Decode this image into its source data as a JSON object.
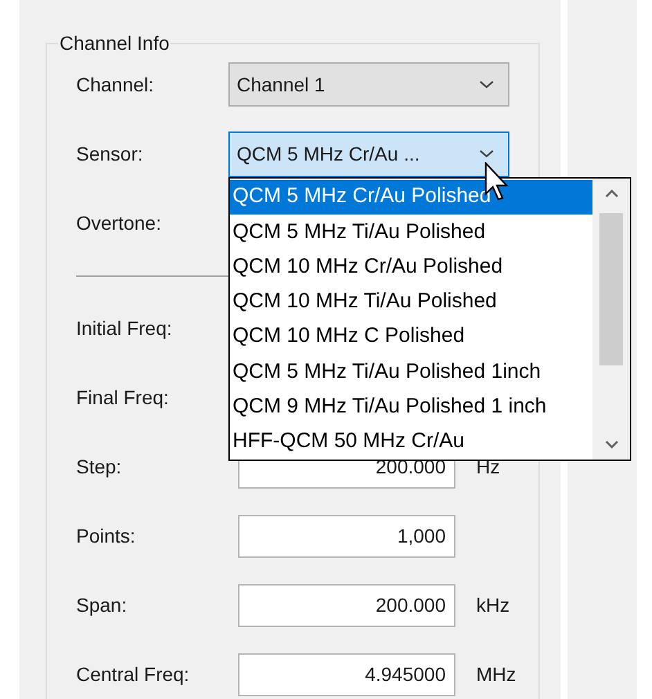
{
  "group": {
    "title": "Channel Info"
  },
  "rows": [
    {
      "kind": "combo",
      "label": "Channel:",
      "value": "Channel 1",
      "focused": false
    },
    {
      "kind": "combo",
      "label": "Sensor:",
      "value": "QCM 5 MHz Cr/Au ...",
      "focused": true
    },
    {
      "kind": "label",
      "label": "Overtone:"
    },
    {
      "kind": "separator"
    },
    {
      "kind": "label",
      "label": "Initial Freq:"
    },
    {
      "kind": "label",
      "label": "Final Freq:"
    },
    {
      "kind": "field",
      "label": "Step:",
      "value": "200.000",
      "unit": "Hz"
    },
    {
      "kind": "field",
      "label": "Points:",
      "value": "1,000"
    },
    {
      "kind": "field",
      "label": "Span:",
      "value": "200.000",
      "unit": "kHz"
    },
    {
      "kind": "field",
      "label": "Central Freq:",
      "value": "4.945000",
      "unit": "MHz"
    }
  ],
  "dropdown": {
    "items": [
      {
        "label": "QCM 5 MHz Cr/Au Polished",
        "selected": true
      },
      {
        "label": "QCM 5 MHz Ti/Au Polished",
        "selected": false
      },
      {
        "label": "QCM 10 MHz Cr/Au Polished",
        "selected": false
      },
      {
        "label": "QCM 10 MHz Ti/Au Polished",
        "selected": false
      },
      {
        "label": "QCM 10 MHz C Polished",
        "selected": false
      },
      {
        "label": "QCM 5 MHz Ti/Au Polished 1inch",
        "selected": false
      },
      {
        "label": "QCM 9 MHz Ti/Au Polished 1 inch",
        "selected": false
      },
      {
        "label": "HFF-QCM 50 MHz Cr/Au",
        "selected": false
      }
    ]
  }
}
